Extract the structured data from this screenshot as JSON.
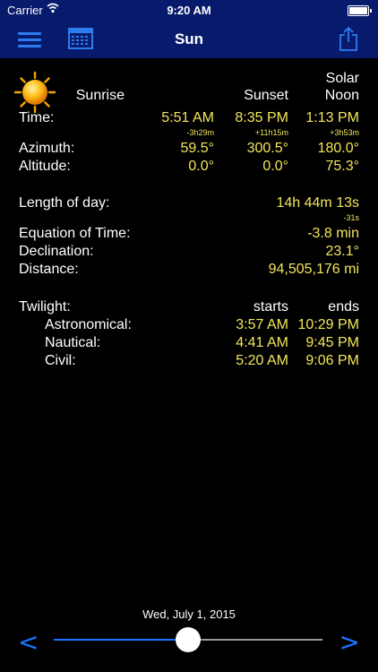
{
  "status_bar": {
    "carrier": "Carrier",
    "time": "9:20 AM"
  },
  "nav": {
    "title": "Sun"
  },
  "icons": {
    "menu": "menu-icon",
    "calendar": "calendar-icon",
    "share": "share-icon",
    "sun": "sun-icon"
  },
  "headers": {
    "sunrise": "Sunrise",
    "sunset": "Sunset",
    "solar_noon_1": "Solar",
    "solar_noon_2": "Noon"
  },
  "time": {
    "label": "Time:",
    "sunrise": "5:51 AM",
    "sunset": "8:35 PM",
    "solar_noon": "1:13 PM",
    "sunrise_delta": "-3h29m",
    "sunset_delta": "+11h15m",
    "solar_noon_delta": "+3h53m"
  },
  "azimuth": {
    "label": "Azimuth:",
    "sunrise": "59.5°",
    "sunset": "300.5°",
    "solar_noon": "180.0°"
  },
  "altitude": {
    "label": "Altitude:",
    "sunrise": "0.0°",
    "sunset": "0.0°",
    "solar_noon": "75.3°"
  },
  "length_of_day": {
    "label": "Length of day:",
    "value": "14h 44m 13s",
    "delta": "-31s"
  },
  "equation_of_time": {
    "label": "Equation of Time:",
    "value": "-3.8 min"
  },
  "declination": {
    "label": "Declination:",
    "value": "23.1°"
  },
  "distance": {
    "label": "Distance:",
    "value": "94,505,176 mi"
  },
  "twilight": {
    "label": "Twilight:",
    "starts_header": "starts",
    "ends_header": "ends",
    "astronomical": {
      "label": "Astronomical:",
      "starts": "3:57 AM",
      "ends": "10:29 PM"
    },
    "nautical": {
      "label": "Nautical:",
      "starts": "4:41 AM",
      "ends": "9:45 PM"
    },
    "civil": {
      "label": "Civil:",
      "starts": "5:20 AM",
      "ends": "9:06 PM"
    }
  },
  "footer": {
    "date": "Wed, July 1, 2015",
    "prev": "<",
    "next": ">",
    "slider_position": 0.5
  },
  "colors": {
    "bar_bg": "#081a6b",
    "accent": "#1a73ff",
    "value": "#f3e65a",
    "background": "#000000"
  }
}
